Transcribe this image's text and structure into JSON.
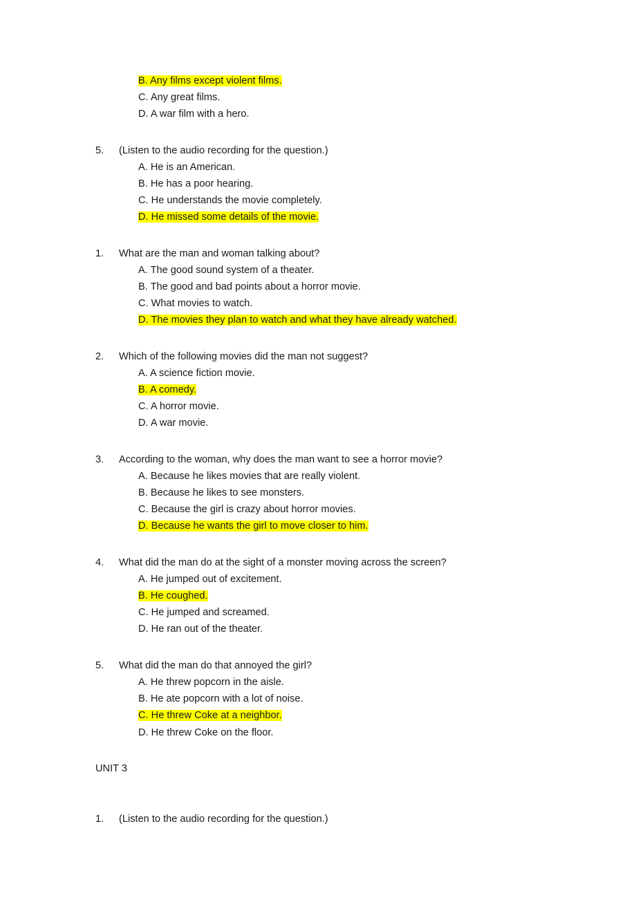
{
  "document": {
    "highlight_color": "#ffff00",
    "text_color": "#1a1a1a",
    "background_color": "#ffffff"
  },
  "blocks": [
    {
      "id": "q4-partial",
      "number": "",
      "question": "",
      "options": [
        {
          "label": "B. Any films except violent films.",
          "highlighted": true
        },
        {
          "label": "C. Any great films.",
          "highlighted": false
        },
        {
          "label": "D. A war film with a hero.",
          "highlighted": false
        }
      ]
    },
    {
      "id": "q5-unit2",
      "number": "5.",
      "question": "(Listen to the audio recording for the question.)",
      "options": [
        {
          "label": "A. He is an American.",
          "highlighted": false
        },
        {
          "label": "B. He has a poor hearing.",
          "highlighted": false
        },
        {
          "label": "C. He understands the movie completely.",
          "highlighted": false
        },
        {
          "label": "D. He missed some details of the movie.",
          "highlighted": true
        }
      ]
    },
    {
      "id": "q1",
      "number": "1.",
      "question": "What are the man and woman talking about?",
      "options": [
        {
          "label": "A. The good sound system of a theater.",
          "highlighted": false
        },
        {
          "label": "B. The good and bad points about a horror movie.",
          "highlighted": false
        },
        {
          "label": "C. What movies to watch.",
          "highlighted": false
        },
        {
          "label": "D. The movies they plan to watch and what they have already watched.",
          "highlighted": true
        }
      ]
    },
    {
      "id": "q2",
      "number": "2.",
      "question": "Which of the following movies did the man not suggest?",
      "options": [
        {
          "label": "A. A science fiction movie.",
          "highlighted": false
        },
        {
          "label": "B. A comedy.",
          "highlighted": true
        },
        {
          "label": "C. A horror movie.",
          "highlighted": false
        },
        {
          "label": "D. A war movie.",
          "highlighted": false
        }
      ]
    },
    {
      "id": "q3",
      "number": "3.",
      "question": "According to the woman, why does the man want to see a horror movie?",
      "options": [
        {
          "label": "A. Because he likes movies that are really violent.",
          "highlighted": false
        },
        {
          "label": "B. Because he likes to see monsters.",
          "highlighted": false
        },
        {
          "label": "C. Because the girl is crazy about horror movies.",
          "highlighted": false
        },
        {
          "label": "D. Because he wants the girl to move closer to him.",
          "highlighted": true
        }
      ]
    },
    {
      "id": "q4",
      "number": "4.",
      "question": "What did the man do at the sight of a monster moving across the screen?",
      "options": [
        {
          "label": "A. He jumped out of excitement.",
          "highlighted": false
        },
        {
          "label": "B. He coughed.",
          "highlighted": true
        },
        {
          "label": "C. He jumped and screamed.",
          "highlighted": false
        },
        {
          "label": "D. He ran out of the theater.",
          "highlighted": false
        }
      ]
    },
    {
      "id": "q5",
      "number": "5.",
      "question": "What did the man do that annoyed the girl?",
      "options": [
        {
          "label": "A. He threw popcorn in the aisle.",
          "highlighted": false
        },
        {
          "label": "B. He ate popcorn with a lot of noise.",
          "highlighted": false
        },
        {
          "label": "C. He threw Coke at a neighbor.",
          "highlighted": true
        },
        {
          "label": "D. He threw Coke on the floor.",
          "highlighted": false
        }
      ]
    }
  ],
  "unit_heading": "UNIT 3",
  "trailing_block": {
    "id": "unit3-q1",
    "number": "1.",
    "question": "(Listen to the audio recording for the question.)",
    "options": []
  }
}
